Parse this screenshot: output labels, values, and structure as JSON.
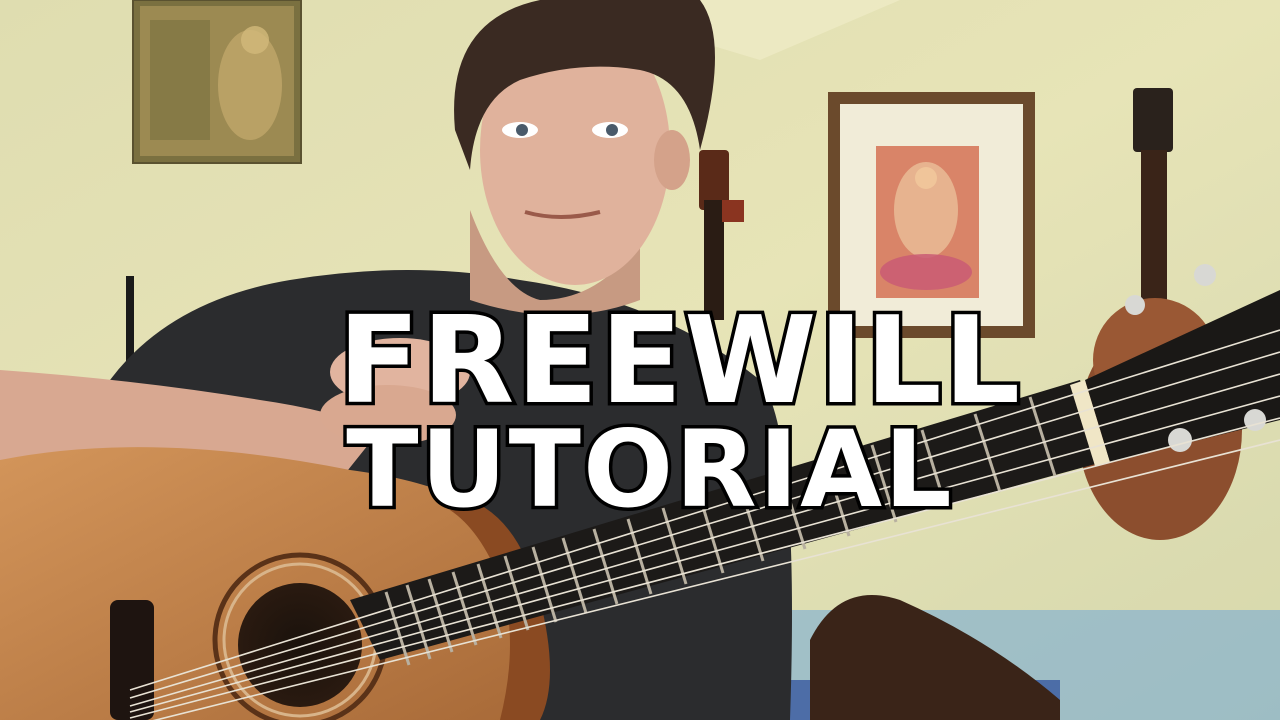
{
  "thumbnail": {
    "title_line_1": "FREEWILL",
    "title_line_2": "TUTORIAL"
  },
  "colors": {
    "wall": "#e2dfae",
    "shirt": "#2b2c2e",
    "guitar_top": "#c8864a",
    "fretboard": "#1c1a18",
    "text_fill": "#ffffff",
    "text_stroke": "#000000"
  }
}
